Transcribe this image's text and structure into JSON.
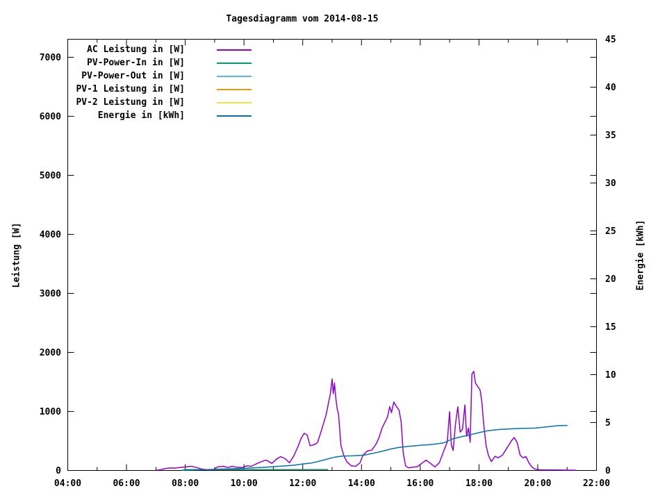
{
  "title": "Tagesdiagramm vom 2014-08-15",
  "axes": {
    "y_left_label": "Leistung [W]",
    "y_right_label": "Energie [kWh]",
    "x_tick_labels": [
      "04:00",
      "06:00",
      "08:00",
      "10:00",
      "12:00",
      "14:00",
      "16:00",
      "18:00",
      "20:00",
      "22:00"
    ],
    "y_left_tick_labels": [
      "0",
      "1000",
      "2000",
      "3000",
      "4000",
      "5000",
      "6000",
      "7000"
    ],
    "y_right_tick_labels": [
      "0",
      "5",
      "10",
      "15",
      "20",
      "25",
      "30",
      "35",
      "40",
      "45"
    ]
  },
  "legend": {
    "entries": [
      {
        "label": "AC Leistung in [W]",
        "color": "#9400d3"
      },
      {
        "label": "PV-Power-In in [W]",
        "color": "#009e73"
      },
      {
        "label": "PV-Power-Out in [W]",
        "color": "#56b4e9"
      },
      {
        "label": "PV-1 Leistung in [W]",
        "color": "#e69f00"
      },
      {
        "label": "PV-2 Leistung in [W]",
        "color": "#f0e442"
      },
      {
        "label": "Energie in [kWh]",
        "color": "#0072b2"
      }
    ]
  },
  "chart_data": {
    "type": "line",
    "title": "Tagesdiagramm vom 2014-08-15",
    "xlabel": "",
    "ylabel": "Leistung [W]",
    "y2label": "Energie [kWh]",
    "x_unit": "hour_of_day",
    "xlim": [
      4,
      22
    ],
    "ylim": [
      0,
      7305
    ],
    "y2lim": [
      0,
      45
    ],
    "x_major_tick_hours": [
      4,
      6,
      8,
      10,
      12,
      14,
      16,
      18,
      20,
      22
    ],
    "x_minor_tick_hours": [
      5,
      7,
      9,
      11,
      13,
      15,
      17,
      19,
      21
    ],
    "y_major_ticks": [
      0,
      1000,
      2000,
      3000,
      4000,
      5000,
      6000,
      7000
    ],
    "y2_major_ticks": [
      0,
      5,
      10,
      15,
      20,
      25,
      30,
      35,
      40,
      45
    ],
    "grid": false,
    "legend_position": "top-left-inside",
    "series": [
      {
        "name": "AC Leistung in [W]",
        "axis": "y",
        "color": "#9400d3",
        "points": [
          [
            7.0,
            5
          ],
          [
            7.15,
            10
          ],
          [
            7.3,
            30
          ],
          [
            7.5,
            45
          ],
          [
            7.65,
            40
          ],
          [
            7.8,
            50
          ],
          [
            8.0,
            60
          ],
          [
            8.2,
            70
          ],
          [
            8.35,
            55
          ],
          [
            8.55,
            25
          ],
          [
            8.75,
            12
          ],
          [
            8.95,
            10
          ],
          [
            9.1,
            60
          ],
          [
            9.3,
            70
          ],
          [
            9.45,
            50
          ],
          [
            9.6,
            70
          ],
          [
            9.75,
            55
          ],
          [
            9.95,
            50
          ],
          [
            10.1,
            80
          ],
          [
            10.25,
            70
          ],
          [
            10.45,
            120
          ],
          [
            10.6,
            150
          ],
          [
            10.75,
            175
          ],
          [
            10.85,
            150
          ],
          [
            10.95,
            120
          ],
          [
            11.1,
            190
          ],
          [
            11.25,
            235
          ],
          [
            11.4,
            200
          ],
          [
            11.55,
            130
          ],
          [
            11.7,
            250
          ],
          [
            11.85,
            420
          ],
          [
            11.95,
            550
          ],
          [
            12.05,
            630
          ],
          [
            12.15,
            600
          ],
          [
            12.25,
            420
          ],
          [
            12.4,
            440
          ],
          [
            12.5,
            470
          ],
          [
            12.62,
            650
          ],
          [
            12.72,
            820
          ],
          [
            12.8,
            950
          ],
          [
            12.88,
            1150
          ],
          [
            12.94,
            1300
          ],
          [
            13.0,
            1550
          ],
          [
            13.04,
            1300
          ],
          [
            13.08,
            1480
          ],
          [
            13.12,
            1250
          ],
          [
            13.17,
            1050
          ],
          [
            13.22,
            950
          ],
          [
            13.3,
            420
          ],
          [
            13.4,
            250
          ],
          [
            13.5,
            150
          ],
          [
            13.65,
            80
          ],
          [
            13.8,
            70
          ],
          [
            13.95,
            130
          ],
          [
            14.05,
            260
          ],
          [
            14.2,
            330
          ],
          [
            14.35,
            345
          ],
          [
            14.5,
            450
          ],
          [
            14.6,
            560
          ],
          [
            14.7,
            720
          ],
          [
            14.8,
            820
          ],
          [
            14.88,
            900
          ],
          [
            14.96,
            1080
          ],
          [
            15.02,
            980
          ],
          [
            15.1,
            1160
          ],
          [
            15.18,
            1090
          ],
          [
            15.28,
            1020
          ],
          [
            15.35,
            820
          ],
          [
            15.42,
            300
          ],
          [
            15.5,
            80
          ],
          [
            15.6,
            45
          ],
          [
            15.75,
            55
          ],
          [
            15.9,
            65
          ],
          [
            16.05,
            120
          ],
          [
            16.2,
            175
          ],
          [
            16.35,
            120
          ],
          [
            16.5,
            60
          ],
          [
            16.65,
            130
          ],
          [
            16.8,
            330
          ],
          [
            16.92,
            480
          ],
          [
            17.0,
            995
          ],
          [
            17.06,
            430
          ],
          [
            17.12,
            340
          ],
          [
            17.2,
            790
          ],
          [
            17.28,
            1080
          ],
          [
            17.36,
            650
          ],
          [
            17.44,
            700
          ],
          [
            17.52,
            1110
          ],
          [
            17.58,
            580
          ],
          [
            17.64,
            720
          ],
          [
            17.7,
            480
          ],
          [
            17.76,
            1630
          ],
          [
            17.82,
            1680
          ],
          [
            17.88,
            1480
          ],
          [
            17.96,
            1420
          ],
          [
            18.04,
            1360
          ],
          [
            18.1,
            1150
          ],
          [
            18.16,
            780
          ],
          [
            18.24,
            430
          ],
          [
            18.32,
            260
          ],
          [
            18.42,
            150
          ],
          [
            18.55,
            240
          ],
          [
            18.65,
            215
          ],
          [
            18.8,
            260
          ],
          [
            18.95,
            380
          ],
          [
            19.1,
            500
          ],
          [
            19.2,
            560
          ],
          [
            19.3,
            470
          ],
          [
            19.4,
            260
          ],
          [
            19.5,
            215
          ],
          [
            19.6,
            235
          ],
          [
            19.7,
            130
          ],
          [
            19.8,
            60
          ],
          [
            19.9,
            25
          ],
          [
            20.05,
            12
          ],
          [
            20.3,
            8
          ],
          [
            20.6,
            8
          ],
          [
            21.0,
            6
          ],
          [
            21.3,
            5
          ]
        ]
      },
      {
        "name": "PV-Power-In in [W]",
        "axis": "y",
        "color": "#009e73",
        "points": [
          [
            7.95,
            15
          ],
          [
            12.85,
            15
          ]
        ]
      },
      {
        "name": "PV-Power-Out in [W]",
        "axis": "y",
        "color": "#56b4e9",
        "points": []
      },
      {
        "name": "PV-1 Leistung in [W]",
        "axis": "y",
        "color": "#e69f00",
        "points": []
      },
      {
        "name": "PV-2 Leistung in [W]",
        "axis": "y",
        "color": "#f0e442",
        "points": []
      },
      {
        "name": "Energie in [kWh]",
        "axis": "y2",
        "color": "#0072b2",
        "points": [
          [
            7.9,
            0.02
          ],
          [
            8.3,
            0.06
          ],
          [
            8.8,
            0.1
          ],
          [
            9.3,
            0.15
          ],
          [
            9.8,
            0.2
          ],
          [
            10.3,
            0.27
          ],
          [
            10.7,
            0.33
          ],
          [
            11.0,
            0.4
          ],
          [
            11.4,
            0.48
          ],
          [
            11.7,
            0.55
          ],
          [
            12.0,
            0.68
          ],
          [
            12.3,
            0.78
          ],
          [
            12.6,
            1.0
          ],
          [
            12.85,
            1.2
          ],
          [
            13.1,
            1.4
          ],
          [
            13.35,
            1.5
          ],
          [
            13.7,
            1.53
          ],
          [
            14.1,
            1.6
          ],
          [
            14.4,
            1.8
          ],
          [
            14.7,
            2.0
          ],
          [
            15.0,
            2.25
          ],
          [
            15.3,
            2.42
          ],
          [
            15.6,
            2.52
          ],
          [
            16.0,
            2.62
          ],
          [
            16.4,
            2.72
          ],
          [
            16.8,
            2.88
          ],
          [
            17.1,
            3.3
          ],
          [
            17.4,
            3.52
          ],
          [
            17.7,
            3.72
          ],
          [
            18.0,
            3.95
          ],
          [
            18.3,
            4.15
          ],
          [
            18.7,
            4.28
          ],
          [
            19.1,
            4.35
          ],
          [
            19.5,
            4.4
          ],
          [
            19.9,
            4.42
          ],
          [
            20.3,
            4.55
          ],
          [
            20.7,
            4.68
          ],
          [
            21.0,
            4.7
          ]
        ]
      }
    ]
  }
}
